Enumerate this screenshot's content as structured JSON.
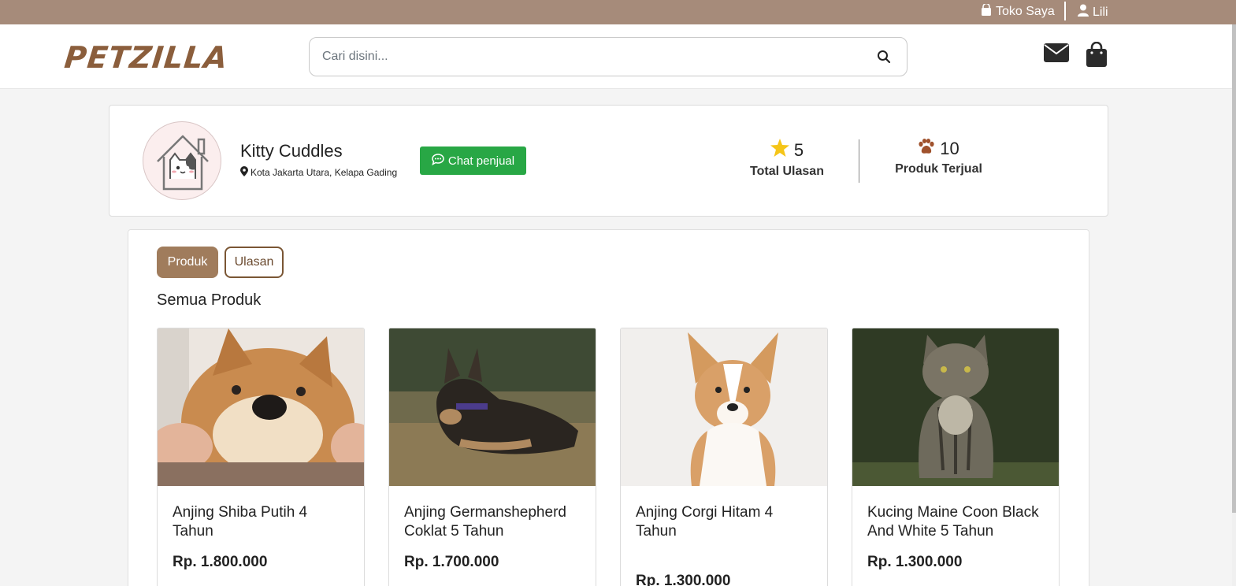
{
  "topbar": {
    "store_label": "Toko Saya",
    "user_label": "Lili",
    "bg_color": "#a68b7a"
  },
  "navbar": {
    "logo": "PETZILLA",
    "search_placeholder": "Cari disini...",
    "icons": [
      "search-icon",
      "mail-icon",
      "shopping-bag-icon"
    ]
  },
  "shop": {
    "name": "Kitty Cuddles",
    "location": "Kota Jakarta Utara, Kelapa Gading",
    "chat_button": "Chat penjual",
    "reviews_count": "5",
    "reviews_label": "Total Ulasan",
    "sold_count": "10",
    "sold_label": "Produk Terjual"
  },
  "tabs": [
    {
      "label": "Produk",
      "active": true
    },
    {
      "label": "Ulasan",
      "active": false
    }
  ],
  "section_title": "Semua Produk",
  "products": [
    {
      "name": "Anjing Shiba Putih 4 Tahun",
      "price": "Rp. 1.800.000",
      "image": "shiba-dog-photo"
    },
    {
      "name": "Anjing Germanshepherd Coklat 5 Tahun",
      "price": "Rp. 1.700.000",
      "image": "german-shepherd-puppy-photo"
    },
    {
      "name": "Anjing Corgi Hitam 4 Tahun",
      "price": "Rp. 1.300.000",
      "image": "corgi-dog-photo"
    },
    {
      "name": "Kucing Maine Coon Black And White 5 Tahun",
      "price": "Rp. 1.300.000",
      "image": "maine-coon-cat-photo"
    }
  ],
  "colors": {
    "brand_brown": "#8b5e3c",
    "tab_active": "#a07c5c",
    "chat_green": "#28a745",
    "star_yellow": "#f5c518",
    "paw_brown": "#a0522d"
  }
}
